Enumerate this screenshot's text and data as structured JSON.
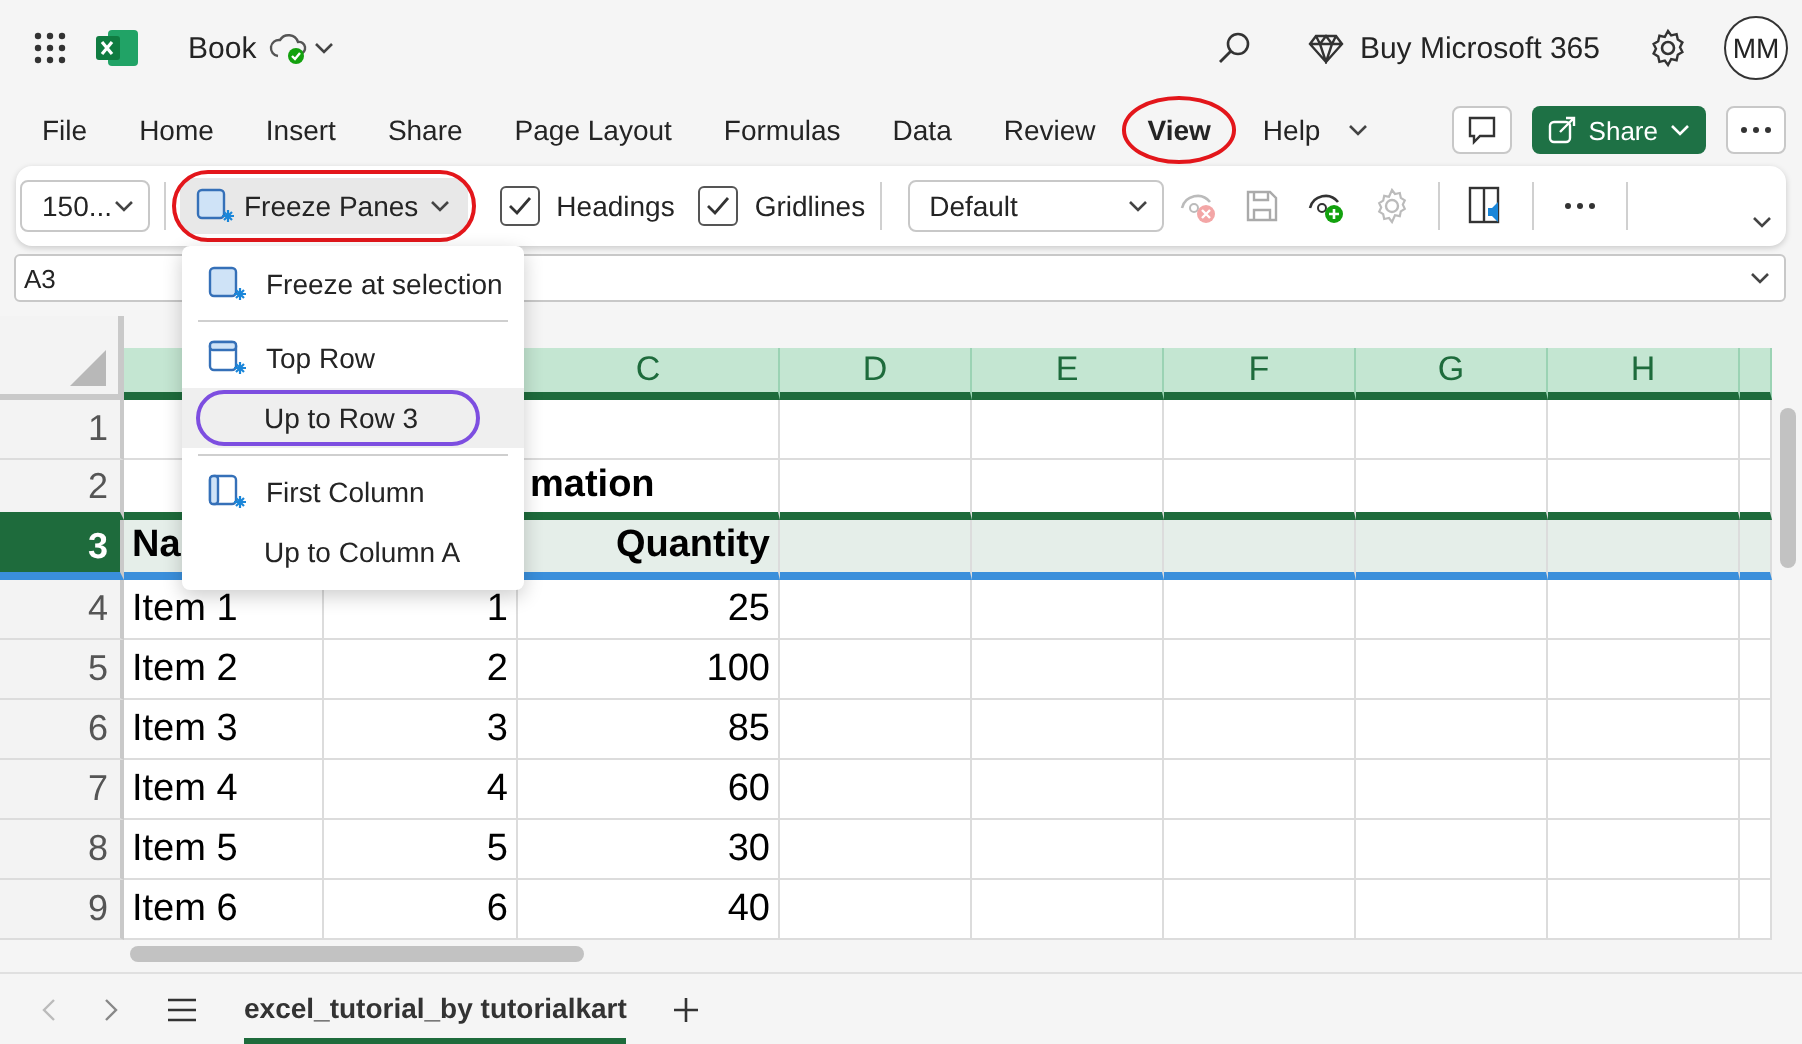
{
  "app": {
    "title": "Book",
    "buy": "Buy Microsoft 365",
    "avatar": "MM"
  },
  "tabs": [
    {
      "label": "File",
      "selected": false,
      "circled": false
    },
    {
      "label": "Home",
      "selected": false,
      "circled": false
    },
    {
      "label": "Insert",
      "selected": false,
      "circled": false
    },
    {
      "label": "Share",
      "selected": false,
      "circled": false
    },
    {
      "label": "Page Layout",
      "selected": false,
      "circled": false
    },
    {
      "label": "Formulas",
      "selected": false,
      "circled": false
    },
    {
      "label": "Data",
      "selected": false,
      "circled": false
    },
    {
      "label": "Review",
      "selected": false,
      "circled": false
    },
    {
      "label": "View",
      "selected": true,
      "circled": true
    },
    {
      "label": "Help",
      "selected": false,
      "circled": false
    }
  ],
  "share_button": "Share",
  "ribbon": {
    "zoom": "150...",
    "freeze_panes": {
      "label": "Freeze Panes",
      "open": true,
      "circled": true
    },
    "checkboxes": [
      {
        "label": "Headings",
        "checked": true
      },
      {
        "label": "Gridlines",
        "checked": true
      }
    ],
    "sheet_view": "Default"
  },
  "name_box": "A3",
  "freeze_menu": [
    {
      "kind": "panes",
      "label": "Freeze at selection",
      "hovered": false,
      "circled": false
    },
    {
      "kind": "divider"
    },
    {
      "kind": "top-row",
      "label": "Top Row",
      "hovered": false,
      "circled": false
    },
    {
      "kind": "plain",
      "label": "Up to Row 3",
      "hovered": true,
      "circled": true
    },
    {
      "kind": "divider"
    },
    {
      "kind": "first-column",
      "label": "First Column",
      "hovered": false,
      "circled": false
    },
    {
      "kind": "plain",
      "label": "Up to Column A",
      "hovered": false,
      "circled": false
    }
  ],
  "columns": [
    "C",
    "D",
    "E",
    "F",
    "G",
    "H"
  ],
  "rows": [
    {
      "header": "1",
      "kind": "data",
      "selected": false
    },
    {
      "header": "2",
      "kind": "heading",
      "selected": false,
      "c": "mation"
    },
    {
      "header": "3",
      "kind": "heading",
      "selected": true,
      "a": "Na",
      "c": "Quantity"
    },
    {
      "header": "4",
      "kind": "data",
      "selected": false,
      "a": "Item 1",
      "b": "1",
      "c": "25"
    },
    {
      "header": "5",
      "kind": "data",
      "selected": false,
      "a": "Item 2",
      "b": "2",
      "c": "100"
    },
    {
      "header": "6",
      "kind": "data",
      "selected": false,
      "a": "Item 3",
      "b": "3",
      "c": "85"
    },
    {
      "header": "7",
      "kind": "data",
      "selected": false,
      "a": "Item 4",
      "b": "4",
      "c": "60"
    },
    {
      "header": "8",
      "kind": "data",
      "selected": false,
      "a": "Item 5",
      "b": "5",
      "c": "30"
    },
    {
      "header": "9",
      "kind": "data",
      "selected": false,
      "a": "Item 6",
      "b": "6",
      "c": "40"
    }
  ],
  "sheets": [
    {
      "label": "excel_tutorial_by tutorialkart",
      "selected": true
    }
  ]
}
